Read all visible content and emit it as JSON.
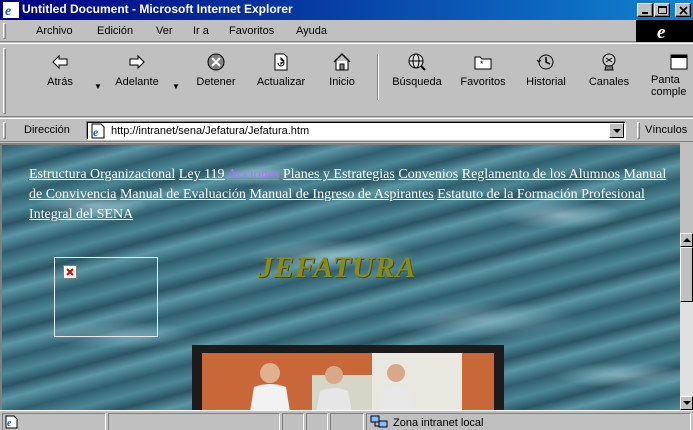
{
  "window": {
    "title": "Untitled Document - Microsoft Internet Explorer"
  },
  "menu": [
    {
      "label": "Archivo"
    },
    {
      "label": "Edición"
    },
    {
      "label": "Ver"
    },
    {
      "label": "Ir a"
    },
    {
      "label": "Favoritos"
    },
    {
      "label": "Ayuda"
    }
  ],
  "toolbar": {
    "back": "Atrás",
    "forward": "Adelante",
    "stop": "Detener",
    "refresh": "Actualizar",
    "home": "Inicio",
    "search": "Búsqueda",
    "favorites": "Favoritos",
    "history": "Historial",
    "channels": "Canales",
    "fullscreen_line1": "Panta",
    "fullscreen_line2": "comple"
  },
  "address": {
    "label": "Dirección",
    "url": "http://intranet/sena/Jefatura/Jefatura.htm",
    "links_label": "Vínculos"
  },
  "page": {
    "links": [
      {
        "text": "Estructura Organizacional",
        "visited": false
      },
      {
        "text": "Ley 119",
        "visited": false
      },
      {
        "text": "Acciones",
        "visited": true
      },
      {
        "text": "Planes y Estrategias",
        "visited": false
      },
      {
        "text": "Convenios",
        "visited": false
      },
      {
        "text": "Reglamento de los Alumnos",
        "visited": false
      },
      {
        "text": "Manual de Convivencia",
        "visited": false
      },
      {
        "text": "Manual de Evaluación",
        "visited": false
      },
      {
        "text": "Manual de Ingreso de Aspirantes",
        "visited": false
      },
      {
        "text": "Estatuto de la Formación Profesional Integral del SENA",
        "visited": false
      }
    ],
    "heading": "JEFATURA"
  },
  "status": {
    "zone": "Zona intranet local"
  },
  "colors": {
    "titlebar_start": "#000080",
    "titlebar_end": "#1084d0",
    "visited_link": "#b070ff",
    "heading": "#8a8a18"
  }
}
